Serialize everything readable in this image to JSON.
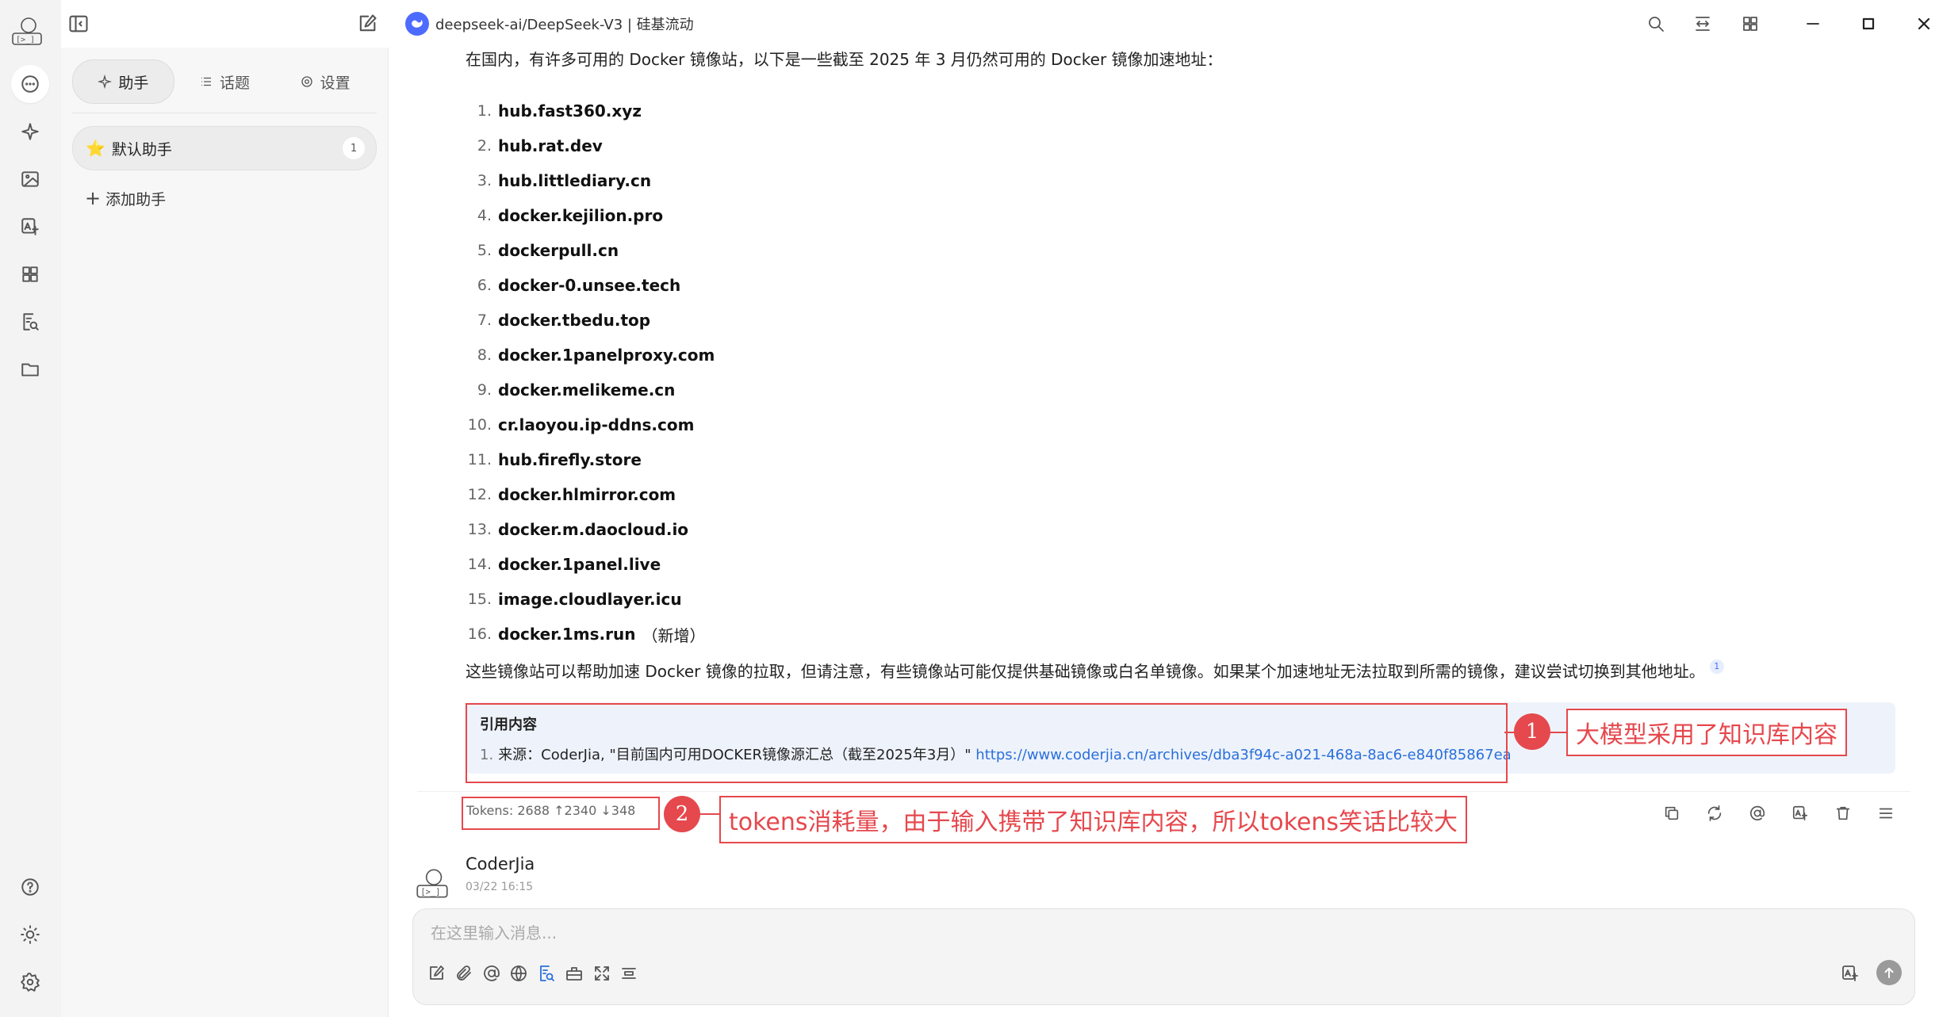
{
  "topbar": {
    "model_title": "deepseek-ai/DeepSeek-V3 | 硅基流动",
    "accent_color": "#4d6bfe",
    "icons": [
      "search-icon",
      "expand-horizontal-icon",
      "grid-icon",
      "minimize-icon",
      "maximize-icon",
      "close-icon"
    ]
  },
  "rail": {
    "items": [
      "chat-icon",
      "sparkle-icon",
      "image-icon",
      "translate-image-icon",
      "apps-icon",
      "knowledge-search-icon",
      "folder-icon"
    ],
    "bottom": [
      "help-icon",
      "theme-sun-icon",
      "settings-gear-icon"
    ]
  },
  "panel": {
    "tabs": [
      {
        "label": "助手",
        "icon": "sparkle-icon"
      },
      {
        "label": "话题",
        "icon": "list-icon"
      },
      {
        "label": "设置",
        "icon": "gear-icon"
      }
    ],
    "assistant": {
      "name": "默认助手",
      "count": "1"
    },
    "add_label": "添加助手"
  },
  "message": {
    "intro": "在国内，有许多可用的 Docker 镜像站，以下是一些截至 2025 年 3 月仍然可用的 Docker 镜像加速地址：",
    "mirrors": [
      {
        "n": "1.",
        "host": "hub.fast360.xyz",
        "note": ""
      },
      {
        "n": "2.",
        "host": "hub.rat.dev",
        "note": ""
      },
      {
        "n": "3.",
        "host": "hub.littlediary.cn",
        "note": ""
      },
      {
        "n": "4.",
        "host": "docker.kejilion.pro",
        "note": ""
      },
      {
        "n": "5.",
        "host": "dockerpull.cn",
        "note": ""
      },
      {
        "n": "6.",
        "host": "docker-0.unsee.tech",
        "note": ""
      },
      {
        "n": "7.",
        "host": "docker.tbedu.top",
        "note": ""
      },
      {
        "n": "8.",
        "host": "docker.1panelproxy.com",
        "note": ""
      },
      {
        "n": "9.",
        "host": "docker.melikeme.cn",
        "note": ""
      },
      {
        "n": "10.",
        "host": "cr.laoyou.ip-ddns.com",
        "note": ""
      },
      {
        "n": "11.",
        "host": "hub.firefly.store",
        "note": ""
      },
      {
        "n": "12.",
        "host": "docker.hlmirror.com",
        "note": ""
      },
      {
        "n": "13.",
        "host": "docker.m.daocloud.io",
        "note": ""
      },
      {
        "n": "14.",
        "host": "docker.1panel.live",
        "note": ""
      },
      {
        "n": "15.",
        "host": "image.cloudlayer.icu",
        "note": ""
      },
      {
        "n": "16.",
        "host": "docker.1ms.run",
        "note": "（新增）"
      }
    ],
    "summary": "这些镜像站可以帮助加速 Docker 镜像的拉取，但请注意，有些镜像站可能仅提供基础镜像或白名单镜像。如果某个加速地址无法拉取到所需的镜像，建议尝试切换到其他地址。",
    "summary_cite": "1",
    "reference": {
      "title": "引用内容",
      "index": "1.",
      "source": "来源：CoderJia, \"目前国内可用DOCKER镜像源汇总（截至2025年3月）\"",
      "url": "https://www.coderjia.cn/archives/dba3f94c-a021-468a-8ac6-e840f85867ea"
    },
    "tokens": "Tokens: 2688 ↑2340 ↓348",
    "actions": [
      "copy-icon",
      "regenerate-icon",
      "mention-icon",
      "translate-icon",
      "delete-icon",
      "menu-icon"
    ]
  },
  "annotations": {
    "one": {
      "num": "1",
      "text": "大模型采用了知识库内容"
    },
    "two": {
      "num": "2",
      "text": "tokens消耗量，由于输入携带了知识库内容，所以tokens笑话比较大"
    },
    "color": "#e5484d"
  },
  "user": {
    "name": "CoderJia",
    "time": "03/22 16:15"
  },
  "composer": {
    "placeholder": "在这里输入消息...",
    "tools": [
      "edit-icon",
      "attachment-icon",
      "mention-icon",
      "web-search-icon",
      "knowledge-base-icon",
      "toolbox-icon",
      "fullscreen-icon",
      "clear-icon"
    ],
    "right": [
      "translate-icon",
      "send-icon"
    ]
  }
}
